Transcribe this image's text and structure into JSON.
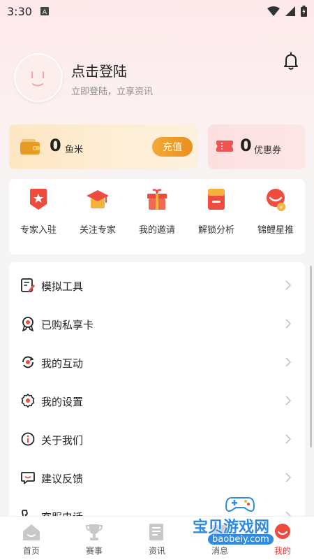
{
  "status_bar": {
    "time": "3:30"
  },
  "profile": {
    "title": "点击登陆",
    "subtitle": "立即登陆，立享资讯"
  },
  "wallet": {
    "amount": "0",
    "unit": "鱼米",
    "recharge_label": "充值"
  },
  "coupon": {
    "amount": "0",
    "unit": "优惠券"
  },
  "quick_actions": [
    {
      "label": "专家入驻",
      "icon": "expert-badge-icon"
    },
    {
      "label": "关注专家",
      "icon": "graduation-cap-icon"
    },
    {
      "label": "我的邀请",
      "icon": "gift-icon"
    },
    {
      "label": "解锁分析",
      "icon": "unlock-doc-icon"
    },
    {
      "label": "锦鲤星推",
      "icon": "koi-star-icon"
    }
  ],
  "menu": [
    {
      "label": "模拟工具",
      "icon": "edit-doc-icon"
    },
    {
      "label": "已购私享卡",
      "icon": "award-icon"
    },
    {
      "label": "我的互动",
      "icon": "interaction-icon"
    },
    {
      "label": "我的设置",
      "icon": "gear-icon"
    },
    {
      "label": "关于我们",
      "icon": "info-icon"
    },
    {
      "label": "建议反馈",
      "icon": "feedback-icon"
    },
    {
      "label": "客服电话",
      "icon": "phone-icon"
    }
  ],
  "tabs": [
    {
      "label": "首页",
      "icon": "home-icon"
    },
    {
      "label": "赛事",
      "icon": "trophy-icon"
    },
    {
      "label": "资讯",
      "icon": "news-icon"
    },
    {
      "label": "消息",
      "icon": "message-icon"
    },
    {
      "label": "我的",
      "icon": "profile-icon",
      "active": true
    }
  ],
  "watermark": {
    "text": "宝贝游戏网",
    "url": "baobeiy.com"
  },
  "colors": {
    "accent": "#e53935",
    "orange": "#ea8f1d",
    "grey_icon": "#8d8d8d"
  }
}
